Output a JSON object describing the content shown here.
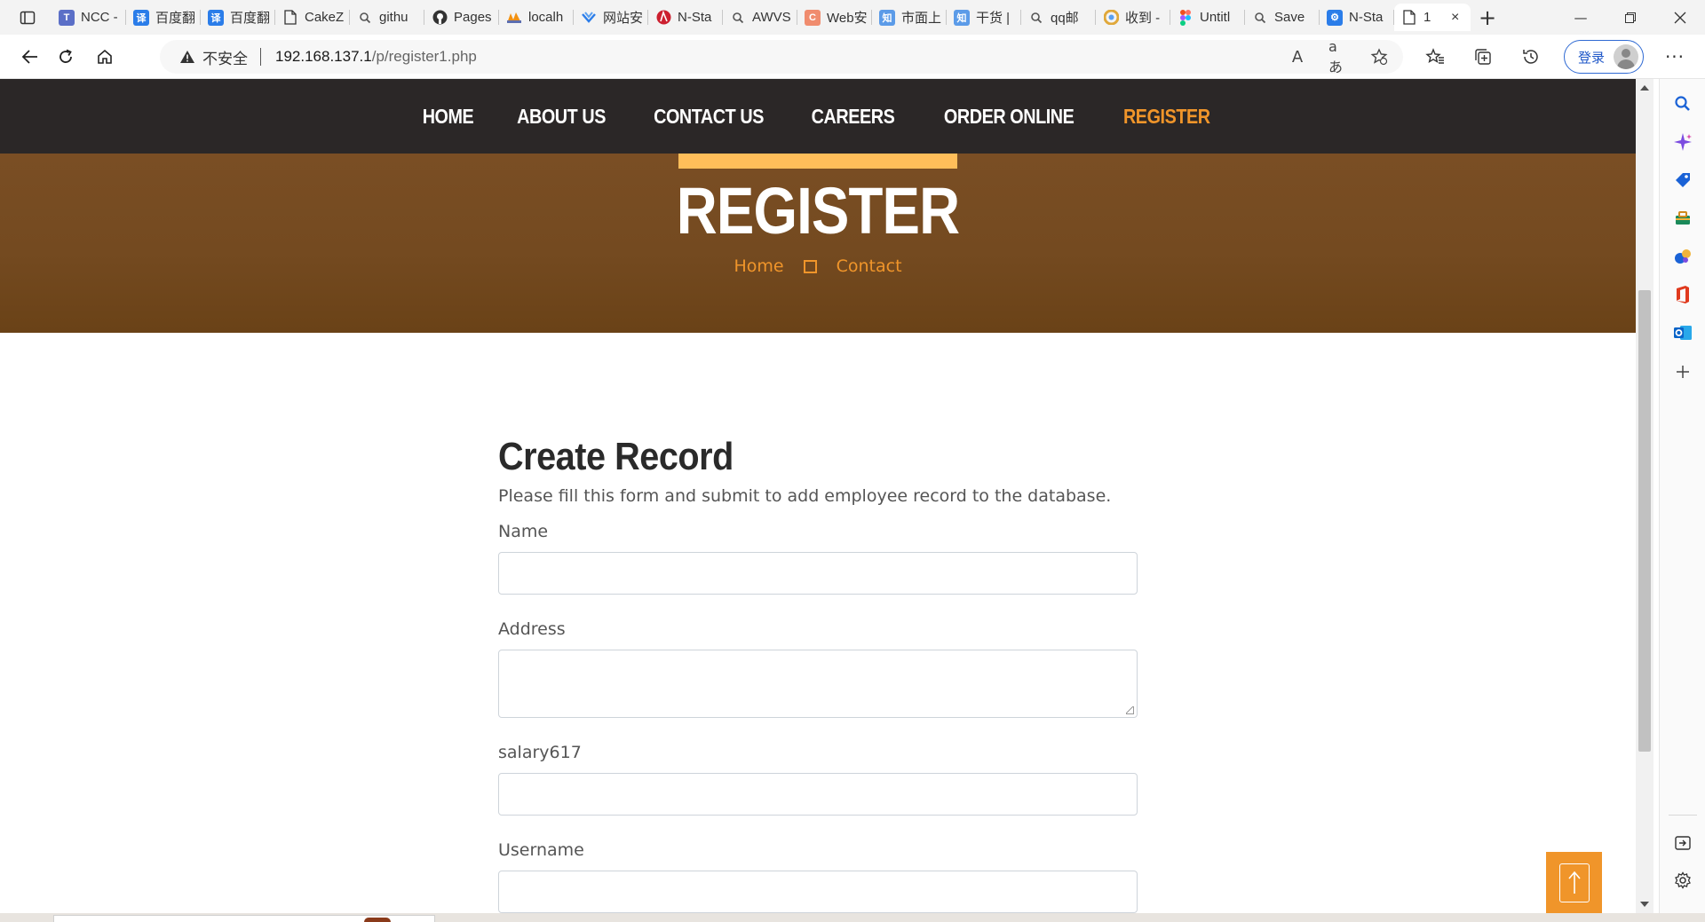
{
  "browser": {
    "tabs": [
      {
        "title": "NCC -",
        "icon": "t-logo-icon",
        "color": "#5b6fc7",
        "glyph": "T"
      },
      {
        "title": "百度翻",
        "icon": "translate-icon",
        "color": "#2b7de9",
        "glyph": "译"
      },
      {
        "title": "百度翻",
        "icon": "translate-icon",
        "color": "#2b7de9",
        "glyph": "译"
      },
      {
        "title": "CakeZ",
        "icon": "page-icon",
        "color": "",
        "glyph": ""
      },
      {
        "title": "githu",
        "icon": "search-icon",
        "color": "",
        "glyph": ""
      },
      {
        "title": "Pages",
        "icon": "github-icon",
        "color": "#333333",
        "glyph": ""
      },
      {
        "title": "localh",
        "icon": "pma-icon",
        "color": "#f29111",
        "glyph": ""
      },
      {
        "title": "网站安",
        "icon": "shield-fav-icon",
        "color": "#2b7de9",
        "glyph": ""
      },
      {
        "title": "N-Sta",
        "icon": "nsta-icon",
        "color": "#cc1f2f",
        "glyph": ""
      },
      {
        "title": "AWVS",
        "icon": "search-icon",
        "color": "",
        "glyph": ""
      },
      {
        "title": "Web安",
        "icon": "c-logo-icon",
        "color": "#f08c6e",
        "glyph": "C"
      },
      {
        "title": "市面上",
        "icon": "zhihu-icon",
        "color": "#5b9be8",
        "glyph": "知"
      },
      {
        "title": "干货 |",
        "icon": "zhihu-icon",
        "color": "#5b9be8",
        "glyph": "知"
      },
      {
        "title": "qq邮",
        "icon": "search-icon",
        "color": "",
        "glyph": ""
      },
      {
        "title": "收到 -",
        "icon": "chrome-like-icon",
        "color": "#e0a83a",
        "glyph": ""
      },
      {
        "title": "Untitl",
        "icon": "figma-icon",
        "color": "#f24e1e",
        "glyph": ""
      },
      {
        "title": "Save",
        "icon": "search-icon",
        "color": "",
        "glyph": ""
      },
      {
        "title": "N-Sta",
        "icon": "tool-icon",
        "color": "#2b7de9",
        "glyph": ""
      },
      {
        "title": "1",
        "icon": "page-icon",
        "color": "",
        "glyph": "",
        "active": true
      }
    ],
    "address": {
      "insecure_label": "不安全",
      "host": "192.168.137.1",
      "path": "/p/register1.php"
    },
    "login_label": "登录"
  },
  "site": {
    "nav": [
      "HOME",
      "ABOUT US",
      "CONTACT US",
      "CAREERS",
      "ORDER ONLINE",
      "REGISTER"
    ],
    "active_nav": "REGISTER",
    "banner": {
      "title": "REGISTER",
      "crumbs": [
        "Home",
        "Contact"
      ]
    },
    "form": {
      "title": "Create Record",
      "description": "Please fill this form and submit to add employee record to the database.",
      "fields": [
        {
          "label": "Name",
          "type": "input",
          "value": ""
        },
        {
          "label": "Address",
          "type": "textarea",
          "value": ""
        },
        {
          "label": "salary617",
          "type": "input",
          "value": ""
        },
        {
          "label": "Username",
          "type": "input",
          "value": ""
        }
      ]
    }
  },
  "colors": {
    "accent": "#f0952a",
    "nav_bg": "#2b2727",
    "banner_bg": "#744a20",
    "banner_bar": "#ffbe5a"
  }
}
